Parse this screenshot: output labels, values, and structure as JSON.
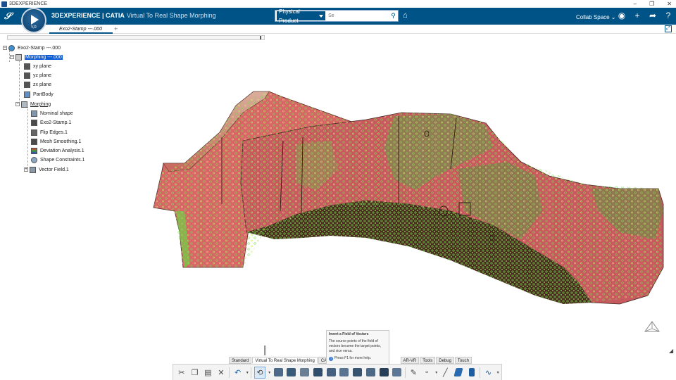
{
  "window": {
    "title": "3DEXPERIENCE",
    "controls": [
      "–",
      "❐",
      "✕"
    ]
  },
  "topbar": {
    "brand_strong": "3DEXPERIENCE | CATIA",
    "brand_app": "Virtual To Real Shape Morphing",
    "compass_label": "V,R",
    "search_context": "Physical Product",
    "search_placeholder": "Se",
    "user_space": "Collab Space ⌄",
    "colors": {
      "bar": "#005386",
      "accent": "#0b5cd6"
    }
  },
  "tabs": [
    {
      "label": "Exo2-Stamp ---.000"
    }
  ],
  "tree": {
    "nodes": [
      {
        "label": "Exo2-Stamp ---.000",
        "icon": "product-icon"
      },
      {
        "label": "Morphing ---.000",
        "icon": "shape-icon",
        "selected": true
      },
      {
        "label": "xy plane",
        "icon": "plane-icon"
      },
      {
        "label": "yz plane",
        "icon": "plane-icon"
      },
      {
        "label": "zx plane",
        "icon": "plane-icon"
      },
      {
        "label": "PartBody",
        "icon": "body-icon"
      },
      {
        "label": "Morphing",
        "icon": "morphing-set-icon"
      },
      {
        "label": "Nominal shape",
        "icon": "nominal-shape-icon"
      },
      {
        "label": "Exo2-Stamp.1",
        "icon": "mesh-icon"
      },
      {
        "label": "Flip Edges.1",
        "icon": "flip-edges-icon"
      },
      {
        "label": "Mesh Smoothing.1",
        "icon": "mesh-smoothing-icon"
      },
      {
        "label": "Deviation Analysis.1",
        "icon": "deviation-analysis-icon"
      },
      {
        "label": "Shape Constraints.1",
        "icon": "shape-constraints-icon"
      },
      {
        "label": "Vector Field.1",
        "icon": "vector-field-icon"
      }
    ]
  },
  "tooltip": {
    "title": "Invert a Field of Vectors",
    "body": "The source points of the field of vectors become the target points, and vice versa.",
    "help": "Press F1 for more help."
  },
  "sections": [
    {
      "label": "Standard"
    },
    {
      "label": "Virtual To Real Shape Morphing",
      "active": true
    },
    {
      "label": "CAA S"
    },
    {
      "label": "AR-VR"
    },
    {
      "label": "Tools"
    },
    {
      "label": "Debug"
    },
    {
      "label": "Touch"
    }
  ],
  "actionbar_icons": [
    "cut-icon",
    "copy-icon",
    "paste-icon",
    "delete-icon",
    "undo-icon",
    "invert-vectors-icon",
    "morph-icon",
    "deviation-icon",
    "mesh-icon",
    "constraint-icon",
    "scan-icon",
    "vector-icon",
    "smooth-icon",
    "fit-icon",
    "analysis-icon",
    "map-icon",
    "sketch-icon",
    "point-icon",
    "line-icon",
    "plane-icon",
    "surface-icon",
    "curve-icon"
  ]
}
